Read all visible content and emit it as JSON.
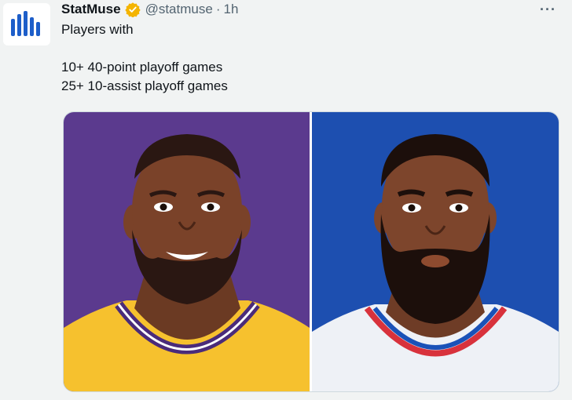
{
  "tweet": {
    "author_name": "StatMuse",
    "author_handle": "@statmuse",
    "separator": "·",
    "time": "1h",
    "more": "···",
    "lines": [
      "Players with",
      "",
      "10+ 40-point playoff games",
      "25+ 10-assist playoff games"
    ]
  },
  "media": {
    "left_panel": {
      "background": "#5b3a8e",
      "jersey": "#f6c12e",
      "trim": "#4a2b7a",
      "icon": "player-illustration-lakers"
    },
    "right_panel": {
      "background": "#1d4fb0",
      "jersey": "#eef1f6",
      "trim_red": "#d8323c",
      "trim_blue": "#1a52b8",
      "icon": "player-illustration-76ers"
    }
  },
  "colors": {
    "verified": "#f4b400",
    "brand_blue": "#1d5ec9"
  }
}
